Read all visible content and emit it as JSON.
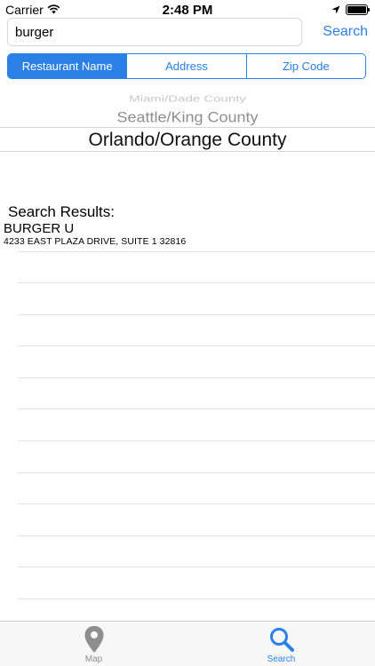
{
  "status_bar": {
    "carrier": "Carrier",
    "time": "2:48 PM"
  },
  "search": {
    "value": "burger",
    "button_label": "Search"
  },
  "segments": [
    {
      "label": "Restaurant Name",
      "selected": true
    },
    {
      "label": "Address",
      "selected": false
    },
    {
      "label": "Zip Code",
      "selected": false
    }
  ],
  "picker": {
    "items": [
      "Miami/Dade County",
      "Seattle/King County",
      "Orlando/Orange County"
    ]
  },
  "results": {
    "heading": "Search Results:",
    "items": [
      {
        "name": "BURGER U",
        "address": "4233 EAST PLAZA DRIVE, SUITE 1 32816"
      }
    ]
  },
  "tab_bar": {
    "tabs": [
      {
        "label": "Map",
        "icon": "map-pin-icon",
        "active": false
      },
      {
        "label": "Search",
        "icon": "search-icon",
        "active": true
      }
    ]
  },
  "colors": {
    "accent": "#2b80e6",
    "inactive_tab": "#8e8e8e"
  }
}
